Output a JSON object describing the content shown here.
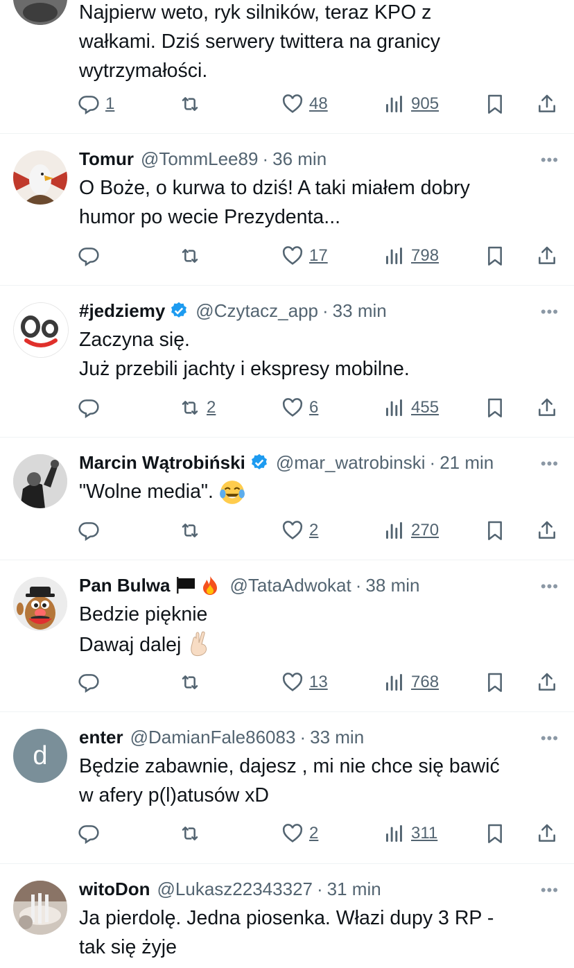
{
  "tweets": [
    {
      "name": "",
      "handle": "",
      "time": "",
      "text": "Najpierw weto, ryk silników, teraz KPO z\nwałkami. Dziś serwery twittera na granicy\nwytrzymałości.",
      "replies": "1",
      "retweets": "",
      "likes": "48",
      "views": "905"
    },
    {
      "name": "Tomur",
      "handle": "@TommLee89",
      "dot": "·",
      "time": "36 min",
      "text": "O Boże, o kurwa to dziś! A taki miałem dobry\nhumor po wecie Prezydenta...",
      "replies": "",
      "retweets": "",
      "likes": "17",
      "views": "798"
    },
    {
      "name": "#jedziemy",
      "handle": "@Czytacz_app",
      "dot": "·",
      "time": "33 min",
      "verified": true,
      "text": "Zaczyna się.\nJuż przebili jachty i ekspresy mobilne.",
      "replies": "",
      "retweets": "2",
      "likes": "6",
      "views": "455"
    },
    {
      "name": "Marcin Wątrobiński",
      "handle": "@mar_watrobinski",
      "dot": "·",
      "time": "21 min",
      "verified": true,
      "text": "\"Wolne media\".",
      "emoji": "laughing-tears-emoji",
      "replies": "",
      "retweets": "",
      "likes": "2",
      "views": "270"
    },
    {
      "name": "Pan Bulwa",
      "handle": "@TataAdwokat",
      "dot": "·",
      "time": "38 min",
      "name_icons": [
        "black-flag-icon",
        "fire-icon"
      ],
      "text": "Bedzie pięknie\nDawaj dalej",
      "emoji": "crossed-fingers-emoji",
      "replies": "",
      "retweets": "",
      "likes": "13",
      "views": "768"
    },
    {
      "name": "enter",
      "handle": "@DamianFale86083",
      "dot": "·",
      "time": "33 min",
      "avatar_letter": "d",
      "text": "Będzie zabawnie, dajesz , mi nie chce się bawić\nw afery p(l)atusów xD",
      "replies": "",
      "retweets": "",
      "likes": "2",
      "views": "311"
    },
    {
      "name": "witoDon",
      "handle": "@Lukasz22343327",
      "dot": "·",
      "time": "31 min",
      "text": "Ja pierdolę. Jedna piosenka. Włazi dupy 3 RP -\ntak się żyje"
    }
  ],
  "more_label": "•••",
  "colors": {
    "text": "#0f1419",
    "secondary": "#536471",
    "verified": "#1d9bf0",
    "separator": "#eff3f4",
    "letter_avatar": "#7a8f99"
  }
}
